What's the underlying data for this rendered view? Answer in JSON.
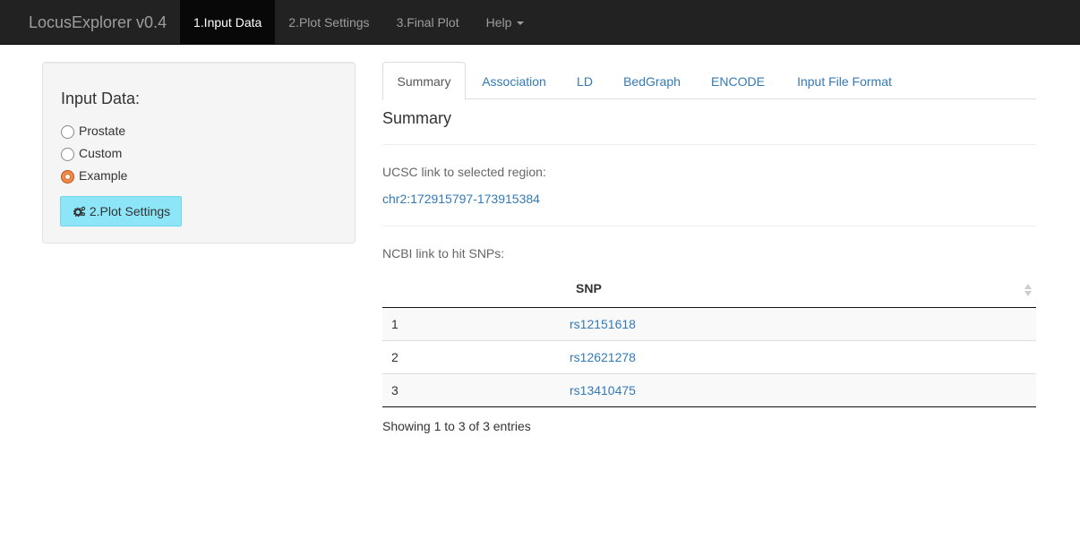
{
  "navbar": {
    "brand": "LocusExplorer v0.4",
    "items": [
      {
        "label": "1.Input Data",
        "active": true
      },
      {
        "label": "2.Plot Settings",
        "active": false
      },
      {
        "label": "3.Final Plot",
        "active": false
      },
      {
        "label": "Help",
        "active": false
      }
    ]
  },
  "sidebar": {
    "title": "Input Data:",
    "options": [
      {
        "label": "Prostate",
        "checked": false
      },
      {
        "label": "Custom",
        "checked": false
      },
      {
        "label": "Example",
        "checked": true
      }
    ],
    "button_label": "2.Plot Settings",
    "button_icon": "cogs-icon"
  },
  "tabs": [
    {
      "label": "Summary",
      "active": true
    },
    {
      "label": "Association",
      "active": false
    },
    {
      "label": "LD",
      "active": false
    },
    {
      "label": "BedGraph",
      "active": false
    },
    {
      "label": "ENCODE",
      "active": false
    },
    {
      "label": "Input File Format",
      "active": false
    }
  ],
  "summary": {
    "title": "Summary",
    "ucsc_label": "UCSC link to selected region:",
    "ucsc_link": "chr2:172915797-173915384",
    "ncbi_label": "NCBI link to hit SNPs:"
  },
  "table": {
    "column_header": "SNP",
    "rows": [
      {
        "index": "1",
        "snp": "rs12151618"
      },
      {
        "index": "2",
        "snp": "rs12621278"
      },
      {
        "index": "3",
        "snp": "rs13410475"
      }
    ],
    "info": "Showing 1 to 3 of 3 entries"
  },
  "colors": {
    "navbar_bg": "#222222",
    "link": "#337ab7",
    "button_info": "#8de6f8",
    "radio_checked": "#d96b2a"
  }
}
